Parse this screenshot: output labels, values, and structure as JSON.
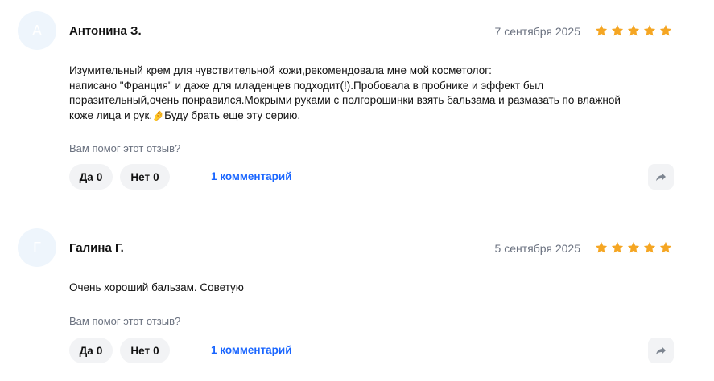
{
  "colors": {
    "star": "#f5a623",
    "link": "#1a66ff",
    "avatar_bg": "#eef5fc",
    "button_bg": "#f2f3f5",
    "muted_text": "#6b7280"
  },
  "reviews": [
    {
      "avatar_letter": "А",
      "author": "Антонина З.",
      "date": "7 сентября 2025",
      "rating": 5,
      "text_lines": [
        "Изумительный крем для чувствительной кожи,рекомендовала мне мой косметолог:",
        "написано \"Франция\" и даже для младенцев подходит(!).Пробовала в пробнике и эффект был",
        "поразительный,очень понравился.Мокрыми руками с полгорошинки взять бальзама и размазать по влажной"
      ],
      "text_last_before_emoji": "коже лица и рук.",
      "emoji_icon": "pinched-fingers-emoji",
      "text_last_after_emoji": "Буду брать еще эту серию.",
      "helpful_question": "Вам помог этот отзыв?",
      "yes_label": "Да",
      "yes_count": "0",
      "no_label": "Нет",
      "no_count": "0",
      "comments_label": "1 комментарий",
      "share_icon": "share-arrow-icon"
    },
    {
      "avatar_letter": "Г",
      "author": "Галина Г.",
      "date": "5 сентября 2025",
      "rating": 5,
      "text": "Очень хороший бальзам. Советую",
      "helpful_question": "Вам помог этот отзыв?",
      "yes_label": "Да",
      "yes_count": "0",
      "no_label": "Нет",
      "no_count": "0",
      "comments_label": "1 комментарий",
      "share_icon": "share-arrow-icon"
    }
  ]
}
